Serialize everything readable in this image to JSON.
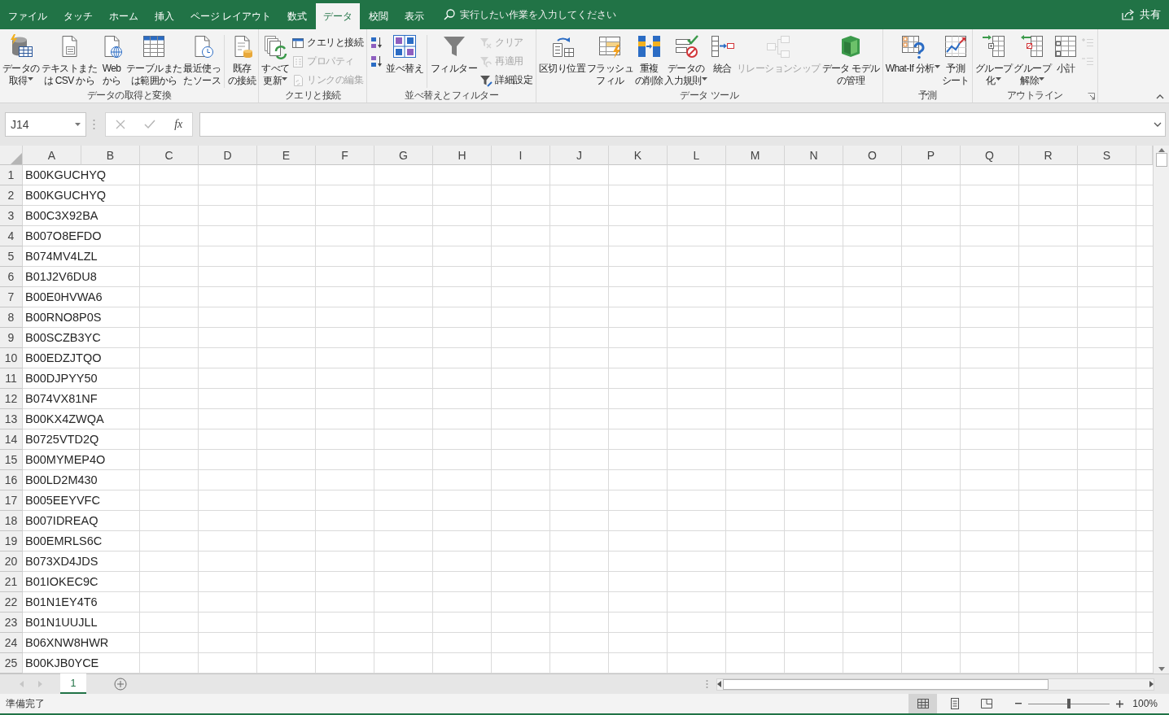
{
  "tabs": [
    {
      "label": "ファイル",
      "selected": false
    },
    {
      "label": "タッチ",
      "selected": false
    },
    {
      "label": "ホーム",
      "selected": false
    },
    {
      "label": "挿入",
      "selected": false
    },
    {
      "label": "ページ レイアウト",
      "selected": false
    },
    {
      "label": "数式",
      "selected": false
    },
    {
      "label": "データ",
      "selected": true
    },
    {
      "label": "校閲",
      "selected": false
    },
    {
      "label": "表示",
      "selected": false
    }
  ],
  "tell_me": {
    "placeholder": "実行したい作業を入力してください"
  },
  "share": {
    "label": "共有"
  },
  "ribbon": {
    "groups": [
      {
        "label": "データの取得と変換",
        "launcher": false,
        "columns": [
          {
            "kind": "large",
            "lines": [
              "データの",
              "取得"
            ],
            "dropdown": true,
            "disabled": false
          },
          {
            "kind": "large",
            "lines": [
              "テキストまた",
              "は CSV から"
            ],
            "dropdown": false,
            "disabled": false
          },
          {
            "kind": "large",
            "lines": [
              "Web",
              "から"
            ],
            "dropdown": false,
            "disabled": false
          },
          {
            "kind": "large",
            "lines": [
              "テーブルまた",
              "は範囲から"
            ],
            "dropdown": false,
            "disabled": false
          },
          {
            "kind": "large",
            "lines": [
              "最近使っ",
              "たソース"
            ],
            "dropdown": false,
            "disabled": false
          },
          {
            "kind": "separator"
          },
          {
            "kind": "large",
            "lines": [
              "既存",
              "の接続"
            ],
            "dropdown": false,
            "disabled": false
          }
        ]
      },
      {
        "label": "クエリと接続",
        "launcher": false,
        "columns": [
          {
            "kind": "large",
            "lines": [
              "すべて",
              "更新"
            ],
            "dropdown": true,
            "disabled": false
          },
          {
            "kind": "stack",
            "items": [
              {
                "label": "クエリと接続",
                "disabled": false
              },
              {
                "label": "プロパティ",
                "disabled": true
              },
              {
                "label": "リンクの編集",
                "disabled": true
              }
            ]
          }
        ]
      },
      {
        "label": "並べ替えとフィルター",
        "launcher": false,
        "columns": [
          {
            "kind": "stack",
            "items": [
              {
                "disabled": false
              },
              {
                "disabled": false
              }
            ]
          },
          {
            "kind": "large",
            "lines": [
              "並べ替え"
            ],
            "dropdown": false,
            "disabled": false
          },
          {
            "kind": "separator"
          },
          {
            "kind": "large",
            "lines": [
              "フィルター"
            ],
            "dropdown": false,
            "disabled": false
          },
          {
            "kind": "stack",
            "items": [
              {
                "label": "クリア",
                "disabled": true
              },
              {
                "label": "再適用",
                "disabled": true
              },
              {
                "label": "詳細設定",
                "disabled": false
              }
            ]
          }
        ]
      },
      {
        "label": "データ ツール",
        "launcher": false,
        "columns": [
          {
            "kind": "large",
            "lines": [
              "区切り位置"
            ],
            "dropdown": false,
            "disabled": false
          },
          {
            "kind": "large",
            "lines": [
              "フラッシュ",
              "フィル"
            ],
            "dropdown": false,
            "disabled": false
          },
          {
            "kind": "large",
            "lines": [
              "重複",
              "の削除"
            ],
            "dropdown": false,
            "disabled": false
          },
          {
            "kind": "large",
            "lines": [
              "データの",
              "入力規則"
            ],
            "dropdown": true,
            "disabled": false
          },
          {
            "kind": "large",
            "lines": [
              "統合"
            ],
            "dropdown": false,
            "disabled": false
          },
          {
            "kind": "large",
            "lines": [
              "リレーションシップ"
            ],
            "dropdown": false,
            "disabled": true
          },
          {
            "kind": "large",
            "lines": [
              "データ モデル",
              "の管理"
            ],
            "dropdown": false,
            "disabled": false
          }
        ]
      },
      {
        "label": "予測",
        "launcher": false,
        "columns": [
          {
            "kind": "large",
            "lines": [
              "What-If 分析"
            ],
            "dropdown": true,
            "disabled": false
          },
          {
            "kind": "large",
            "lines": [
              "予測",
              "シート"
            ],
            "dropdown": false,
            "disabled": false
          }
        ]
      },
      {
        "label": "アウトライン",
        "launcher": true,
        "columns": [
          {
            "kind": "large",
            "lines": [
              "グループ",
              "化"
            ],
            "dropdown": true,
            "disabled": false
          },
          {
            "kind": "large",
            "lines": [
              "グループ",
              "解除"
            ],
            "dropdown": true,
            "disabled": false
          },
          {
            "kind": "large",
            "lines": [
              "小計"
            ],
            "dropdown": false,
            "disabled": false
          },
          {
            "kind": "stack",
            "items": [
              {
                "disabled": true
              },
              {
                "disabled": true
              }
            ]
          }
        ]
      }
    ]
  },
  "formula_bar": {
    "name_box": "J14",
    "function_label": "fx"
  },
  "sheet": {
    "columns": [
      "A",
      "B",
      "C",
      "D",
      "E",
      "F",
      "G",
      "H",
      "I",
      "J",
      "K",
      "L",
      "M",
      "N",
      "O",
      "P",
      "Q",
      "R",
      "S"
    ],
    "rows": [
      {
        "number": "1",
        "values": [
          "B00KGUCHYQ"
        ]
      },
      {
        "number": "2",
        "values": [
          "B00KGUCHYQ"
        ]
      },
      {
        "number": "3",
        "values": [
          "B00C3X92BA"
        ]
      },
      {
        "number": "4",
        "values": [
          "B007O8EFDO"
        ]
      },
      {
        "number": "5",
        "values": [
          "B074MV4LZL"
        ]
      },
      {
        "number": "6",
        "values": [
          "B01J2V6DU8"
        ]
      },
      {
        "number": "7",
        "values": [
          "B00E0HVWA6"
        ]
      },
      {
        "number": "8",
        "values": [
          "B00RNO8P0S"
        ]
      },
      {
        "number": "9",
        "values": [
          "B00SCZB3YC"
        ]
      },
      {
        "number": "10",
        "values": [
          "B00EDZJTQO"
        ]
      },
      {
        "number": "11",
        "values": [
          "B00DJPYY50"
        ]
      },
      {
        "number": "12",
        "values": [
          "B074VX81NF"
        ]
      },
      {
        "number": "13",
        "values": [
          "B00KX4ZWQA"
        ]
      },
      {
        "number": "14",
        "values": [
          "B0725VTD2Q"
        ]
      },
      {
        "number": "15",
        "values": [
          "B00MYMEP4O"
        ]
      },
      {
        "number": "16",
        "values": [
          "B00LD2M430"
        ]
      },
      {
        "number": "17",
        "values": [
          "B005EEYVFC"
        ]
      },
      {
        "number": "18",
        "values": [
          "B007IDREAQ"
        ]
      },
      {
        "number": "19",
        "values": [
          "B00EMRLS6C"
        ]
      },
      {
        "number": "20",
        "values": [
          "B073XD4JDS"
        ]
      },
      {
        "number": "21",
        "values": [
          "B01IOKEC9C"
        ]
      },
      {
        "number": "22",
        "values": [
          "B01N1EY4T6"
        ]
      },
      {
        "number": "23",
        "values": [
          "B01N1UUJLL"
        ]
      },
      {
        "number": "24",
        "values": [
          "B06XNW8HWR"
        ]
      },
      {
        "number": "25",
        "values": [
          "B00KJB0YCE"
        ]
      }
    ]
  },
  "sheet_tabs": [
    {
      "label": "1",
      "selected": true
    }
  ],
  "status_bar": {
    "status": "準備完了",
    "views": [
      {
        "selected": true
      },
      {
        "selected": false
      },
      {
        "selected": false
      }
    ],
    "zoom": {
      "level": 0.5,
      "reading": "100%"
    }
  }
}
